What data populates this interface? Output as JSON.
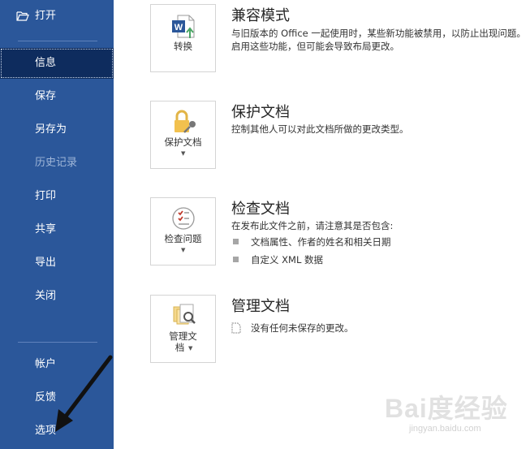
{
  "sidebar": {
    "open": "打开",
    "items": [
      {
        "label": "信息"
      },
      {
        "label": "保存"
      },
      {
        "label": "另存为"
      },
      {
        "label": "历史记录"
      },
      {
        "label": "打印"
      },
      {
        "label": "共享"
      },
      {
        "label": "导出"
      },
      {
        "label": "关闭"
      }
    ],
    "bottom": [
      {
        "label": "帐户"
      },
      {
        "label": "反馈"
      },
      {
        "label": "选项"
      }
    ]
  },
  "sections": {
    "compat": {
      "title": "兼容模式",
      "desc_line1": "与旧版本的 Office 一起使用时，某些新功能被禁用，以防止出现问题。",
      "desc_line2": "启用这些功能，但可能会导致布局更改。",
      "button": "转换",
      "icon": "word-convert-icon"
    },
    "protect": {
      "title": "保护文档",
      "desc": "控制其他人可以对此文档所做的更改类型。",
      "button": "保护文档",
      "icon": "lock-key-icon"
    },
    "inspect": {
      "title": "检查文档",
      "desc": "在发布此文件之前，请注意其是否包含:",
      "bullets": [
        "文档属性、作者的姓名和相关日期",
        "自定义 XML 数据"
      ],
      "button": "检查问题",
      "icon": "checklist-icon"
    },
    "manage": {
      "title": "管理文档",
      "desc": "没有任何未保存的更改。",
      "button_line1": "管理文",
      "button_line2": "档",
      "icon": "documents-search-icon"
    }
  },
  "watermark": {
    "main": "Bai度经验",
    "sub": "jingyan.baidu.com"
  },
  "colors": {
    "sidebar_bg": "#2b579a",
    "sidebar_active": "#0e2c5e",
    "sidebar_disabled_text": "#9fb6d8"
  }
}
